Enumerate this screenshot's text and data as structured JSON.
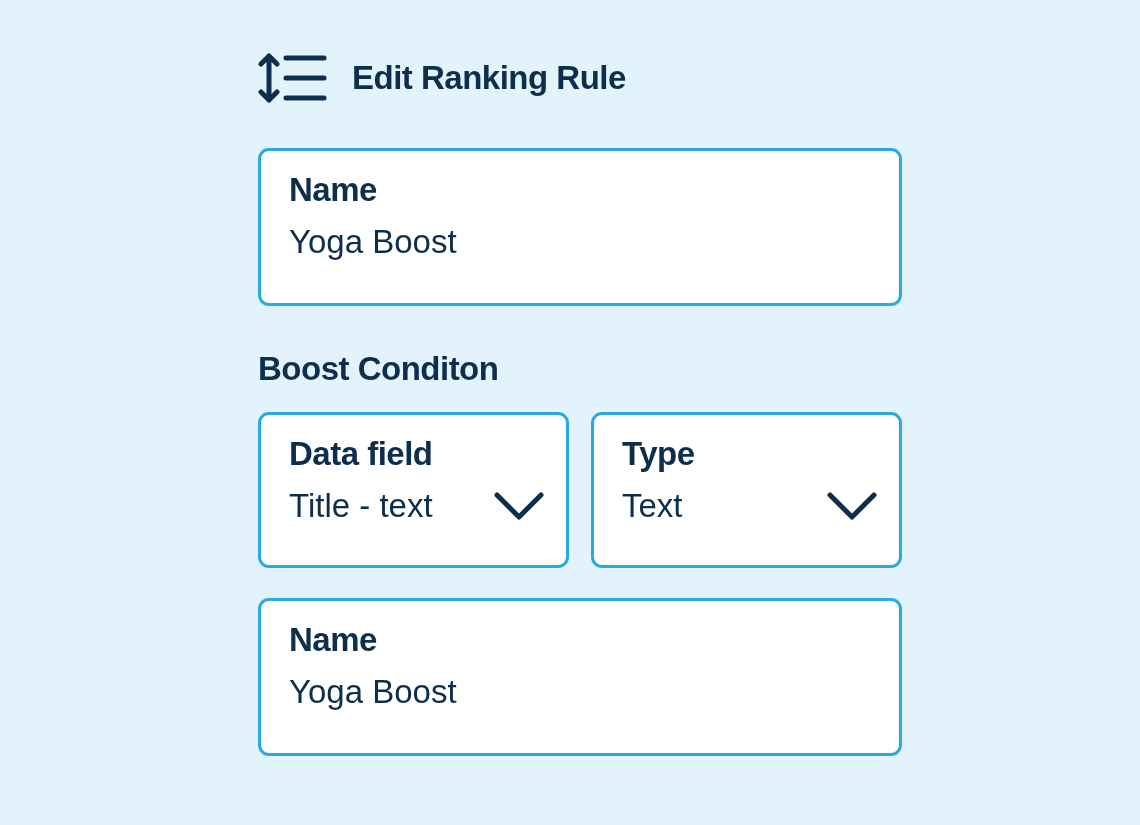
{
  "header": {
    "title": "Edit Ranking Rule"
  },
  "name_field": {
    "label": "Name",
    "value": "Yoga Boost"
  },
  "boost_condition": {
    "title": "Boost Conditon",
    "selects": [
      {
        "label": "Data field",
        "value": "Title - text"
      },
      {
        "label": "Type",
        "value": "Text"
      }
    ],
    "name_field": {
      "label": "Name",
      "value": "Yoga Boost"
    }
  }
}
